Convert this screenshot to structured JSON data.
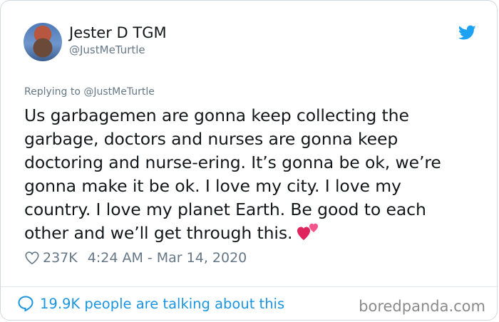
{
  "user": {
    "name": "Jester D TGM",
    "handle": "@JustMeTurtle"
  },
  "reply": {
    "prefix": "Replying to",
    "handle": "@JustMeTurtle"
  },
  "tweet": {
    "lines": [
      "Us garbagemen are gonna keep collecting the",
      "garbage, doctors and nurses are gonna keep",
      "doctoring and nurse-ering. It’s gonna be ok, we’re",
      "gonna make it be ok. I love my city. I love my",
      "country. I love my planet Earth. Be good to each",
      "other and we’ll get through this."
    ],
    "emoji": "two-hearts"
  },
  "meta": {
    "likes": "237K",
    "timestamp": "4:24 AM - Mar 14, 2020"
  },
  "footer": {
    "talking": "19.9K people are talking about this",
    "watermark": "boredpanda.com"
  },
  "colors": {
    "twitter_blue": "#1da1f2",
    "link_blue": "#1b95e0",
    "text": "#14171a",
    "muted": "#657786",
    "heart_red": "#e0245e"
  },
  "icons": [
    "twitter-bird-icon",
    "like-heart-icon",
    "conversation-bubble-icon",
    "two-hearts-emoji"
  ]
}
